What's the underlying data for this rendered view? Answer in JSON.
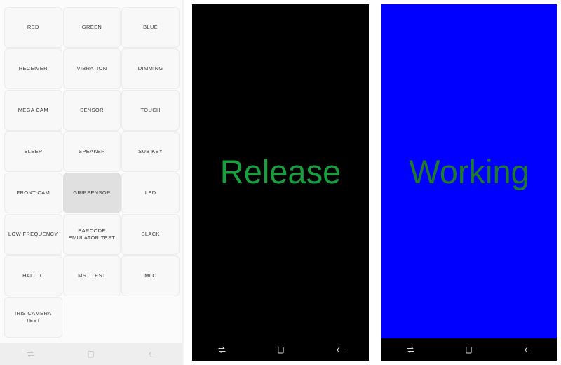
{
  "panels": {
    "menu": {
      "name": "factory-test-menu",
      "background_color": "#fbfbfb",
      "buttons": [
        {
          "label": "RED",
          "selected": false
        },
        {
          "label": "GREEN",
          "selected": false
        },
        {
          "label": "BLUE",
          "selected": false
        },
        {
          "label": "RECEIVER",
          "selected": false
        },
        {
          "label": "VIBRATION",
          "selected": false
        },
        {
          "label": "DIMMING",
          "selected": false
        },
        {
          "label": "MEGA CAM",
          "selected": false
        },
        {
          "label": "SENSOR",
          "selected": false
        },
        {
          "label": "TOUCH",
          "selected": false
        },
        {
          "label": "SLEEP",
          "selected": false
        },
        {
          "label": "SPEAKER",
          "selected": false
        },
        {
          "label": "SUB KEY",
          "selected": false
        },
        {
          "label": "FRONT CAM",
          "selected": false
        },
        {
          "label": "GRIPSENSOR",
          "selected": true
        },
        {
          "label": "LED",
          "selected": false
        },
        {
          "label": "LOW FREQUENCY",
          "selected": false
        },
        {
          "label": "BARCODE EMULATOR TEST",
          "selected": false
        },
        {
          "label": "BLACK",
          "selected": false
        },
        {
          "label": "HALL IC",
          "selected": false
        },
        {
          "label": "MST TEST",
          "selected": false
        },
        {
          "label": "MLC",
          "selected": false
        },
        {
          "label": "IRIS CAMERA TEST",
          "selected": false
        }
      ],
      "navbar": {
        "theme": "light",
        "background_color": "#eeeeee",
        "icon_color": "#c3c3c3",
        "items": [
          {
            "icon": "recents-icon",
            "label": "Recents"
          },
          {
            "icon": "home-square-icon",
            "label": "Home"
          },
          {
            "icon": "back-arrow-icon",
            "label": "Back"
          }
        ]
      }
    },
    "release": {
      "name": "gripsensor-release-state",
      "background_color": "#000000",
      "status_text": "Release",
      "status_color": "#18a03e",
      "navbar": {
        "theme": "dark",
        "background_color": "#000000",
        "icon_color": "#d8d8d8",
        "items": [
          {
            "icon": "recents-icon",
            "label": "Recents"
          },
          {
            "icon": "home-square-icon",
            "label": "Home"
          },
          {
            "icon": "back-arrow-icon",
            "label": "Back"
          }
        ]
      }
    },
    "working": {
      "name": "gripsensor-working-state",
      "background_color": "#0000ff",
      "status_text": "Working",
      "status_color": "#1f7a2e",
      "navbar": {
        "theme": "dark",
        "background_color": "#000000",
        "icon_color": "#d8d8d8",
        "items": [
          {
            "icon": "recents-icon",
            "label": "Recents"
          },
          {
            "icon": "home-square-icon",
            "label": "Home"
          },
          {
            "icon": "back-arrow-icon",
            "label": "Back"
          }
        ]
      }
    }
  }
}
